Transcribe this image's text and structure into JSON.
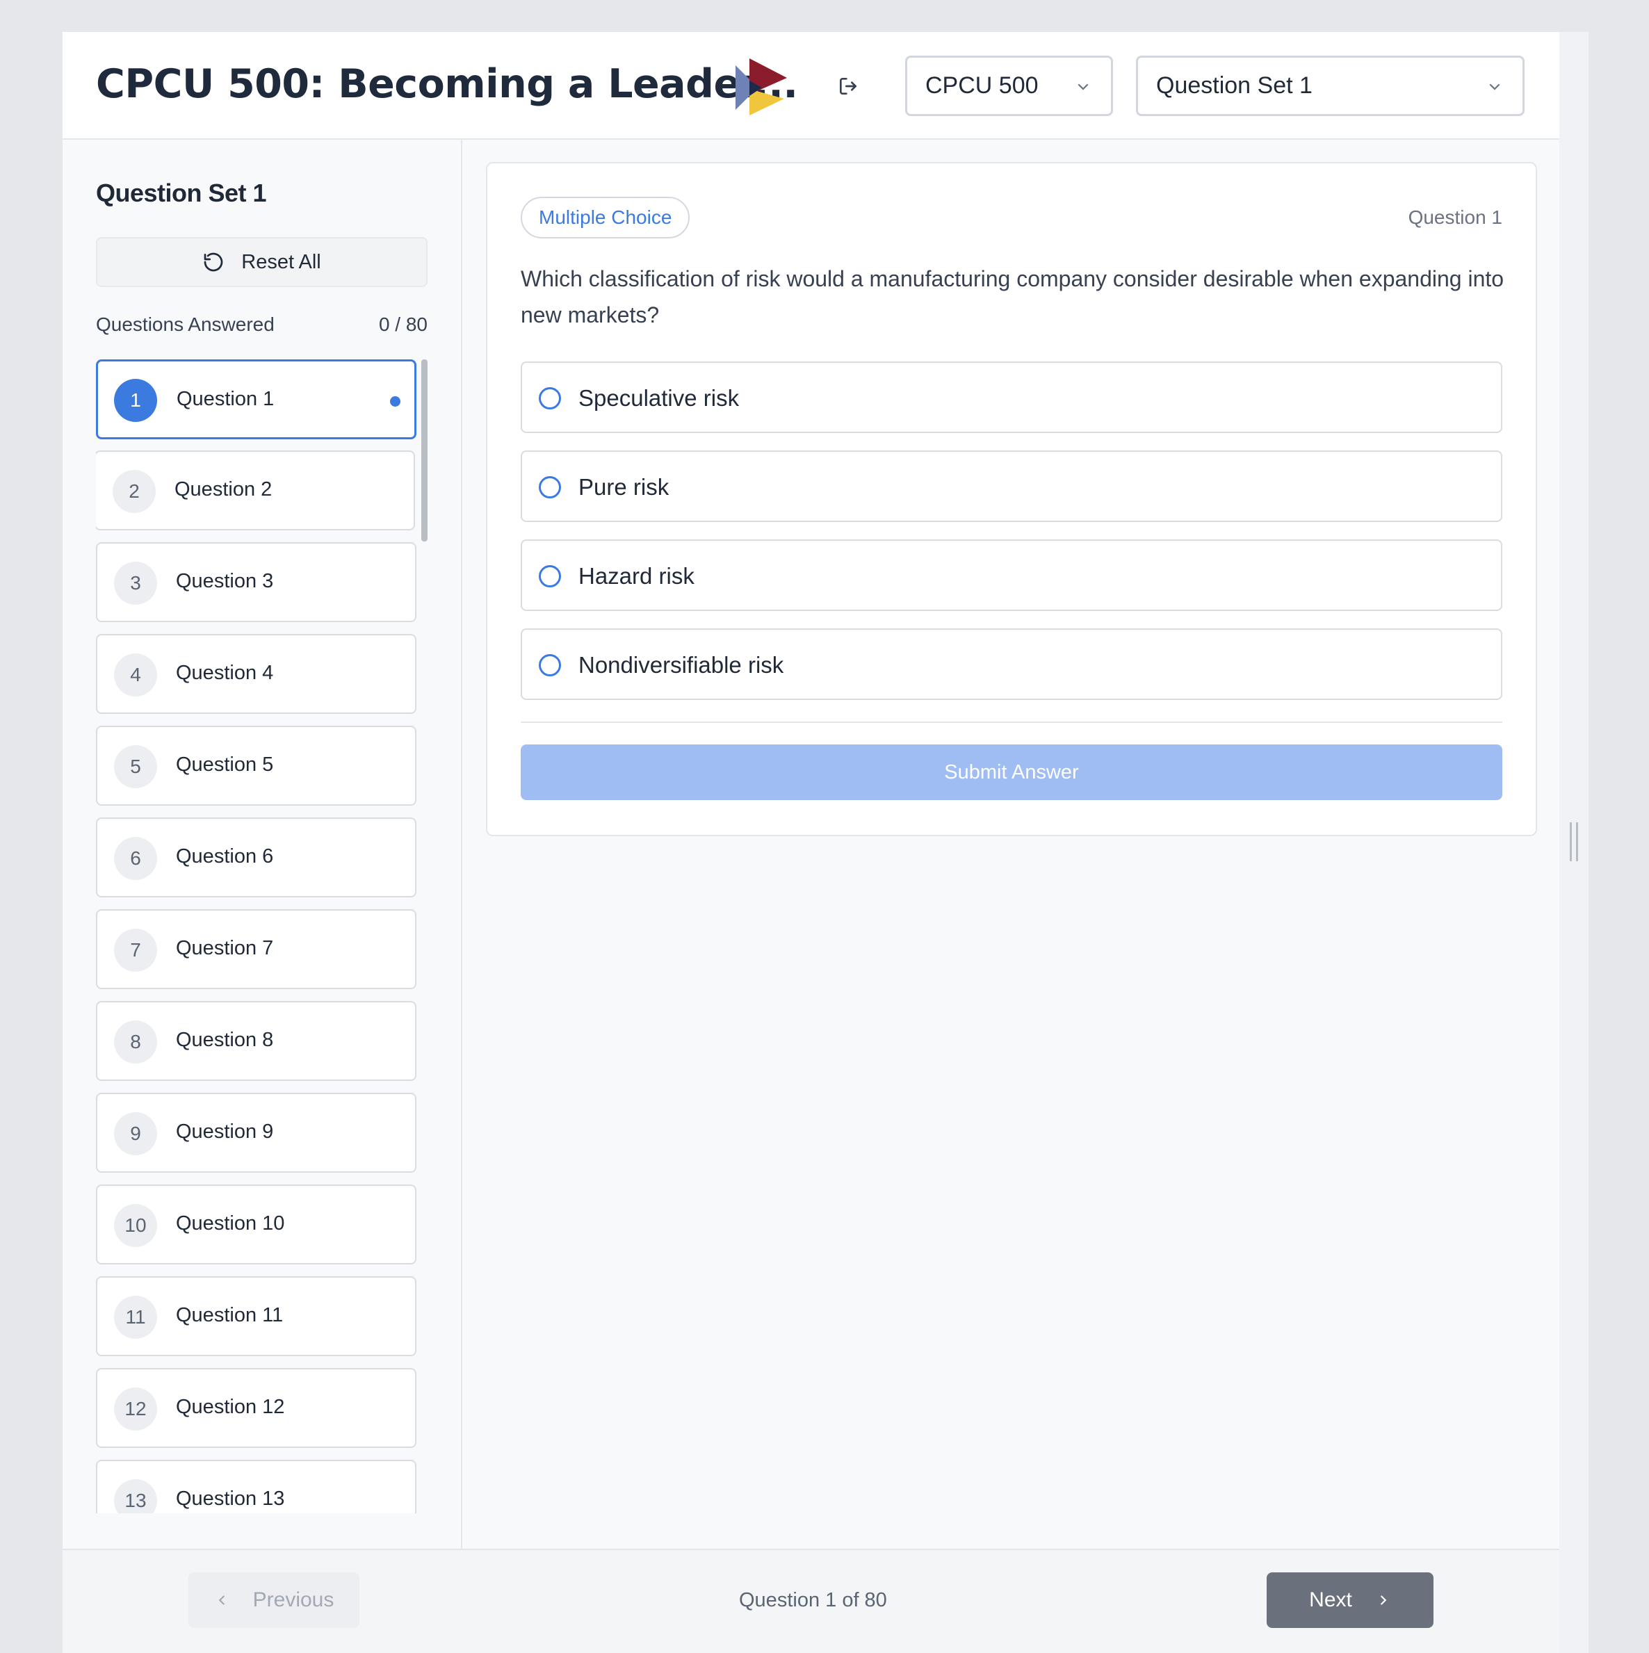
{
  "header": {
    "title": "CPCU 500: Becoming a Leader...",
    "course_select": "CPCU 500",
    "set_select": "Question Set 1"
  },
  "icons": {
    "logout": "logout-icon",
    "chevron": "chevron-down-icon",
    "reset": "reset-icon",
    "prev": "chevron-left-icon",
    "next": "chevron-right-icon"
  },
  "colors": {
    "accent": "#3b7be0",
    "logo_red": "#8b1c2c",
    "logo_blue": "#6e82b5",
    "logo_yellow": "#f0c63c",
    "logo_navy": "#1e2a4a"
  },
  "sidebar": {
    "title": "Question Set 1",
    "reset_label": "Reset All",
    "answered_label": "Questions Answered",
    "answered_count": "0 / 80",
    "questions": [
      {
        "num": "1",
        "label": "Question 1"
      },
      {
        "num": "2",
        "label": "Question 2"
      },
      {
        "num": "3",
        "label": "Question 3"
      },
      {
        "num": "4",
        "label": "Question 4"
      },
      {
        "num": "5",
        "label": "Question 5"
      },
      {
        "num": "6",
        "label": "Question 6"
      },
      {
        "num": "7",
        "label": "Question 7"
      },
      {
        "num": "8",
        "label": "Question 8"
      },
      {
        "num": "9",
        "label": "Question 9"
      },
      {
        "num": "10",
        "label": "Question 10"
      },
      {
        "num": "11",
        "label": "Question 11"
      },
      {
        "num": "12",
        "label": "Question 12"
      },
      {
        "num": "13",
        "label": "Question 13"
      }
    ]
  },
  "main": {
    "type_badge": "Multiple Choice",
    "question_index": "Question 1",
    "question_text": "Which classification of risk would a manufacturing company consider desirable when expanding into new markets?",
    "options": [
      "Speculative risk",
      "Pure risk",
      "Hazard risk",
      "Nondiversifiable risk"
    ],
    "submit_label": "Submit Answer"
  },
  "footer": {
    "prev_label": "Previous",
    "status": "Question 1 of 80",
    "next_label": "Next"
  }
}
